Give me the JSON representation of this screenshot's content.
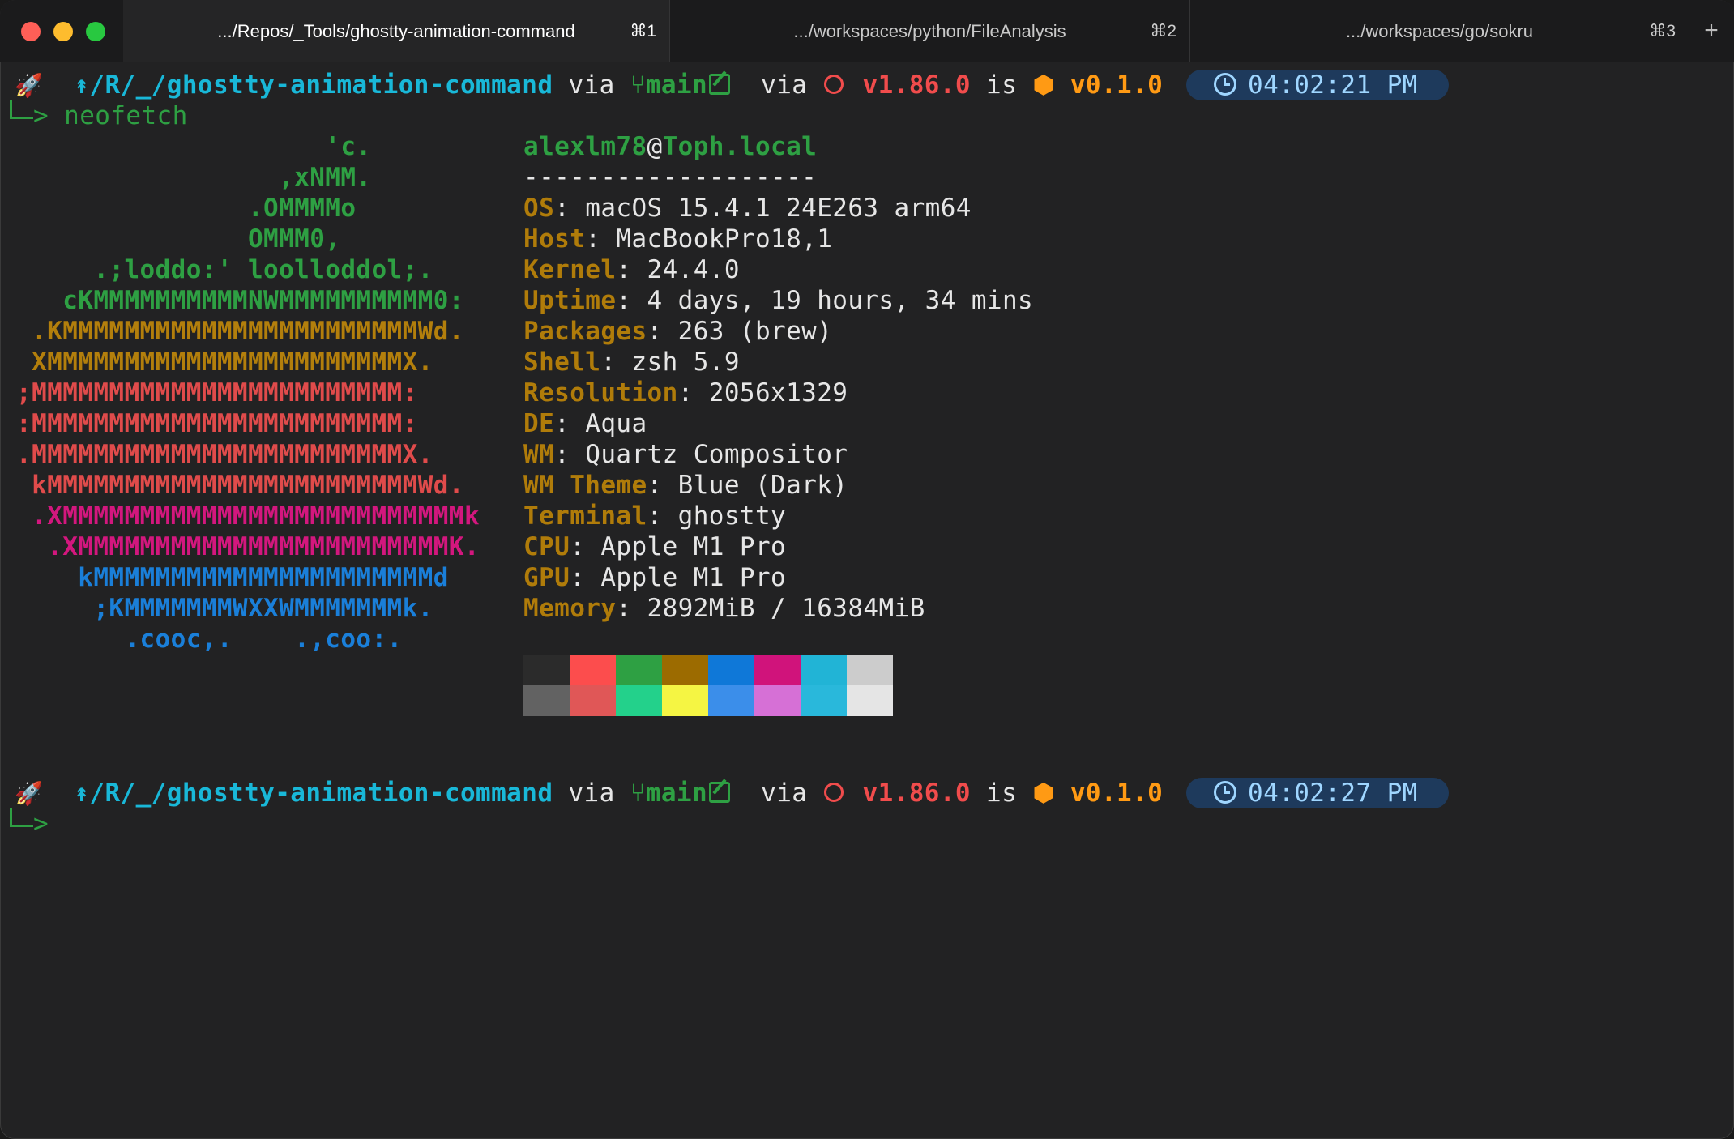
{
  "tabs": [
    {
      "title": ".../Repos/_Tools/ghostty-animation-command",
      "shortcut": "⌘1"
    },
    {
      "title": ".../workspaces/python/FileAnalysis",
      "shortcut": "⌘2"
    },
    {
      "title": ".../workspaces/go/sokru",
      "shortcut": "⌘3"
    }
  ],
  "new_tab_label": "+",
  "prompt1": {
    "rocket": "🚀",
    "path": "↟/R/_/ghostty-animation-command",
    "via1": "via",
    "branch_icon": "⑂",
    "branch": "main",
    "via2": "via",
    "rust_version": "v1.86.0",
    "is": "is",
    "pkg_icon": "⬢",
    "pkg_version": "v0.1.0",
    "time": "04:02:21 PM",
    "command_arrow": ">",
    "command": "neofetch"
  },
  "ascii_logo": [
    "                    'c.",
    "                 ,xNMM.",
    "               .OMMMMo",
    "               OMMM0,",
    "     .;loddo:' loolloddol;.",
    "   cKMMMMMMMMMMNWMMMMMMMMMM0:",
    " .KMMMMMMMMMMMMMMMMMMMMMMMWd.",
    " XMMMMMMMMMMMMMMMMMMMMMMMX.",
    ";MMMMMMMMMMMMMMMMMMMMMMMM:",
    ":MMMMMMMMMMMMMMMMMMMMMMMM:",
    ".MMMMMMMMMMMMMMMMMMMMMMMMX.",
    " kMMMMMMMMMMMMMMMMMMMMMMMMWd.",
    " .XMMMMMMMMMMMMMMMMMMMMMMMMMMk",
    "  .XMMMMMMMMMMMMMMMMMMMMMMMMK.",
    "    kMMMMMMMMMMMMMMMMMMMMMMd",
    "     ;KMMMMMMMWXXWMMMMMMMk.",
    "       .cooc,.    .,coo:."
  ],
  "user": "alexlm78",
  "at": "@",
  "host": "Toph.local",
  "separator": "-------------------",
  "info": [
    {
      "key": "OS",
      "value": "macOS 15.4.1 24E263 arm64"
    },
    {
      "key": "Host",
      "value": "MacBookPro18,1"
    },
    {
      "key": "Kernel",
      "value": "24.4.0"
    },
    {
      "key": "Uptime",
      "value": "4 days, 19 hours, 34 mins"
    },
    {
      "key": "Packages",
      "value": "263 (brew)"
    },
    {
      "key": "Shell",
      "value": "zsh 5.9"
    },
    {
      "key": "Resolution",
      "value": "2056x1329"
    },
    {
      "key": "DE",
      "value": "Aqua"
    },
    {
      "key": "WM",
      "value": "Quartz Compositor"
    },
    {
      "key": "WM Theme",
      "value": "Blue (Dark)"
    },
    {
      "key": "Terminal",
      "value": "ghostty"
    },
    {
      "key": "CPU",
      "value": "Apple M1 Pro"
    },
    {
      "key": "GPU",
      "value": "Apple M1 Pro"
    },
    {
      "key": "Memory",
      "value": "2892MiB / 16384MiB"
    }
  ],
  "colon": ": ",
  "palette": {
    "row1": [
      "#2b2b2b",
      "#fc4d4d",
      "#2ea043",
      "#9c6b00",
      "#0f78d8",
      "#d0137b",
      "#21b4d6",
      "#cccccc"
    ],
    "row2": [
      "#626262",
      "#e05757",
      "#23d18b",
      "#f5f543",
      "#3b8eea",
      "#d670d6",
      "#29b8db",
      "#e5e5e5"
    ]
  },
  "prompt2": {
    "rocket": "🚀",
    "path": "↟/R/_/ghostty-animation-command",
    "via1": "via",
    "branch_icon": "⑂",
    "branch": "main",
    "via2": "via",
    "rust_version": "v1.86.0",
    "is": "is",
    "pkg_icon": "⬢",
    "pkg_version": "v0.1.0",
    "time": "04:02:27 PM",
    "command_arrow": ">"
  }
}
